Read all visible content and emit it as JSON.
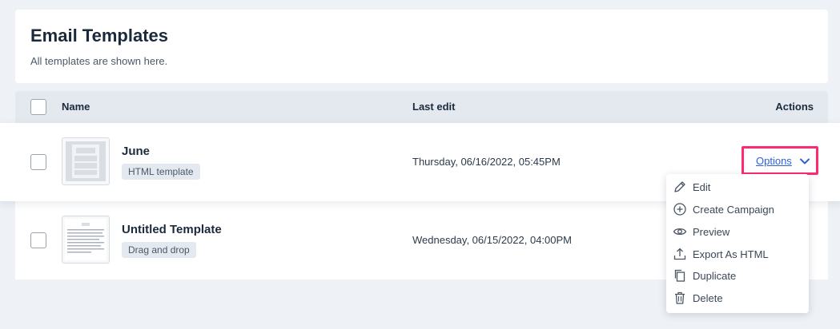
{
  "header": {
    "title": "Email Templates",
    "subtitle": "All templates are shown here."
  },
  "table": {
    "columns": {
      "name": "Name",
      "last_edit": "Last edit",
      "actions": "Actions"
    },
    "rows": [
      {
        "name": "June",
        "tag": "HTML template",
        "last_edit": "Thursday, 06/16/2022, 05:45PM",
        "checked": false
      },
      {
        "name": "Untitled Template",
        "tag": "Drag and drop",
        "last_edit": "Wednesday, 06/15/2022, 04:00PM",
        "checked": false
      }
    ]
  },
  "actions": {
    "options_label": "Options",
    "menu": [
      {
        "label": "Edit",
        "icon": "pencil-icon"
      },
      {
        "label": "Create Campaign",
        "icon": "plus-circle-icon"
      },
      {
        "label": "Preview",
        "icon": "eye-icon"
      },
      {
        "label": "Export As HTML",
        "icon": "upload-icon"
      },
      {
        "label": "Duplicate",
        "icon": "copy-icon"
      },
      {
        "label": "Delete",
        "icon": "trash-icon"
      }
    ]
  },
  "colors": {
    "background": "#eef2f6",
    "header_row": "#e4e9ef",
    "link": "#2f62d8",
    "highlight": "#ff2a6d"
  }
}
